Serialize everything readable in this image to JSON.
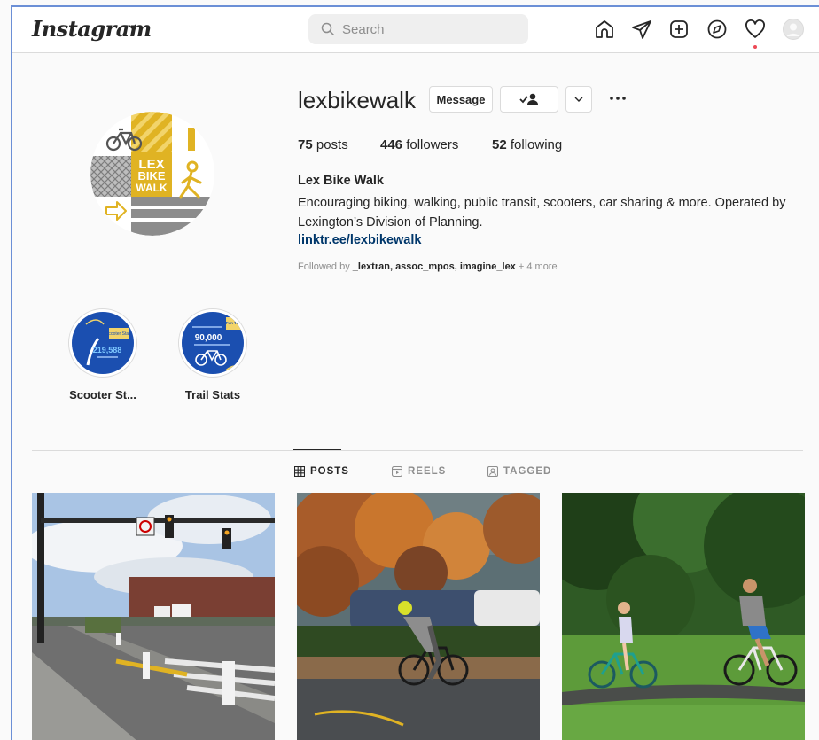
{
  "nav": {
    "logo": "Instagram",
    "search_placeholder": "Search",
    "icons": [
      "home-icon",
      "direct-icon",
      "new-post-icon",
      "explore-icon",
      "activity-icon",
      "profile-avatar"
    ]
  },
  "profile": {
    "username": "lexbikewalk",
    "message_label": "Message",
    "posts_count": "75",
    "posts_label": "posts",
    "followers_count": "446",
    "followers_label": "followers",
    "following_count": "52",
    "following_label": "following",
    "full_name": "Lex Bike Walk",
    "bio": "Encouraging biking, walking, public transit, scooters, car sharing & more. Operated by Lexington’s Division of Planning.",
    "link": "linktr.ee/lexbikewalk",
    "followed_by_prefix": "Followed by",
    "followed_by_names": "_lextran, assoc_mpos, imagine_lex",
    "followed_by_more": "+ 4 more"
  },
  "avatar_logo": {
    "line1": "LEX",
    "line2": "BIKE",
    "line3": "WALK"
  },
  "highlights": [
    {
      "label": "Scooter St...",
      "number": "219,588",
      "badge": "Scooter Stats"
    },
    {
      "label": "Trail Stats",
      "number": "90,000",
      "badge": "Fun Trail"
    }
  ],
  "tabs": [
    {
      "label": "POSTS",
      "active": true
    },
    {
      "label": "REELS",
      "active": false
    },
    {
      "label": "TAGGED",
      "active": false
    }
  ],
  "colors": {
    "brand_yellow": "#e0b323",
    "link_blue": "#00376b",
    "highlight_blue": "#1b4fb0"
  }
}
